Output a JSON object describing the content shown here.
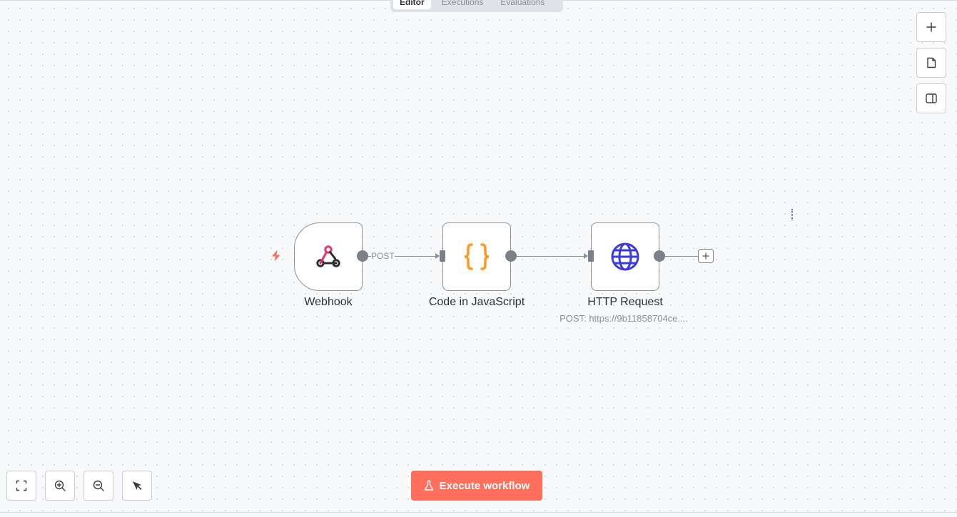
{
  "tabs": [
    {
      "label": "Editor",
      "active": true
    },
    {
      "label": "Executions",
      "active": false
    },
    {
      "label": "Evaluations",
      "active": false
    }
  ],
  "right_toolbar": [
    "plus-icon",
    "sticky-note-icon",
    "panel-toggle-icon"
  ],
  "nodes": [
    {
      "label": "Webhook",
      "icon": "webhook-icon",
      "trigger": true
    },
    {
      "label": "Code in JavaScript",
      "icon": "curly-braces-icon"
    },
    {
      "label": "HTTP Request",
      "icon": "globe-icon",
      "subtitle": "POST: https://9b11858704ce...."
    }
  ],
  "edges": [
    {
      "label": "POST"
    }
  ],
  "bottom_controls": [
    "fit-view-icon",
    "zoom-in-icon",
    "zoom-out-icon",
    "tidy-up-icon"
  ],
  "execute_button": {
    "label": "Execute workflow"
  },
  "colors": {
    "accent": "#ff6f5c",
    "node_border": "#8d9098",
    "code_icon": "#ff9922",
    "globe_icon": "#3b3bd9",
    "webhook_red": "#e8336c"
  }
}
